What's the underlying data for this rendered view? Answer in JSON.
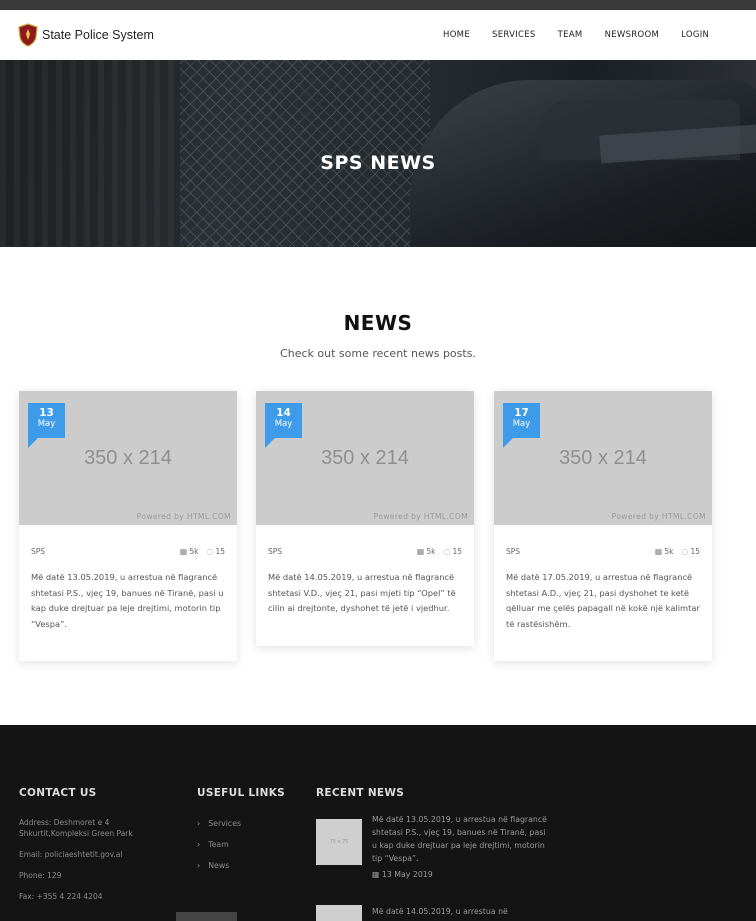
{
  "brand": {
    "name": "State Police System"
  },
  "nav": [
    "HOME",
    "SERVICES",
    "TEAM",
    "NEWSROOM",
    "LOGIN"
  ],
  "hero": {
    "title": "SPS NEWS"
  },
  "section": {
    "title": "NEWS",
    "subtitle": "Check out some recent news posts."
  },
  "cards": [
    {
      "day": "13",
      "month": "May",
      "placeholder": "350 x 214",
      "powered": "Powered by HTML.COM",
      "category": "SPS",
      "views": "5k",
      "comments": "15",
      "text": "Më datë 13.05.2019, u arrestua në flagrancë shtetasi P.S., vjeç 19, banues në Tiranë, pasi u kap duke drejtuar pa leje drejtimi, motorin tip “Vespa”."
    },
    {
      "day": "14",
      "month": "May",
      "placeholder": "350 x 214",
      "powered": "Powered by HTML.COM",
      "category": "SPS",
      "views": "5k",
      "comments": "15",
      "text": "Më datë 14.05.2019, u arrestua në flagrancë shtetasi V.D., vjeç 21, pasi mjeti tip “Opel” të cilin ai drejtonte, dyshohet të jetë i vjedhur."
    },
    {
      "day": "17",
      "month": "May",
      "placeholder": "350 x 214",
      "powered": "Powered by HTML.COM",
      "category": "SPS",
      "views": "5k",
      "comments": "15",
      "text": "Më datë 17.05.2019, u arrestua në flagrancë shtetasi A.D., vjeç 21, pasi dyshohet te ketë qëlluar me çelës papagall në kokë një kalimtar të rastësishëm."
    }
  ],
  "footer": {
    "contact": {
      "title": "CONTACT US",
      "address": "Address: Deshmoret e 4 Shkurtit,Kompleksi Green Park",
      "email": "Email: policiaeshtetit.gov.al",
      "phone": "Phone: 129",
      "fax": "Fax: +355 4 224 4204"
    },
    "links": {
      "title": "USEFUL LINKS",
      "items": [
        "Services",
        "Team",
        "News"
      ]
    },
    "recent": {
      "title": "RECENT NEWS",
      "thumb": "75 x 75",
      "items": [
        {
          "text": "Më datë 13.05.2019, u arrestua në flagrancë shtetasi P.S., vjeç 19, banues në Tiranë, pasi u kap duke drejtuar pa leje drejtimi, motorin tip “Vespa”.",
          "date": "13 May 2019"
        },
        {
          "text": "Më datë 14.05.2019, u arrestua në"
        }
      ]
    }
  },
  "colors": {
    "accent": "#3d9be9",
    "footer_bg": "#141414"
  },
  "icons": {
    "logo": "police-shield-icon",
    "views": "calendar-icon",
    "comments": "comment-icon",
    "link": "chevron-right-icon",
    "date": "calendar-icon"
  }
}
